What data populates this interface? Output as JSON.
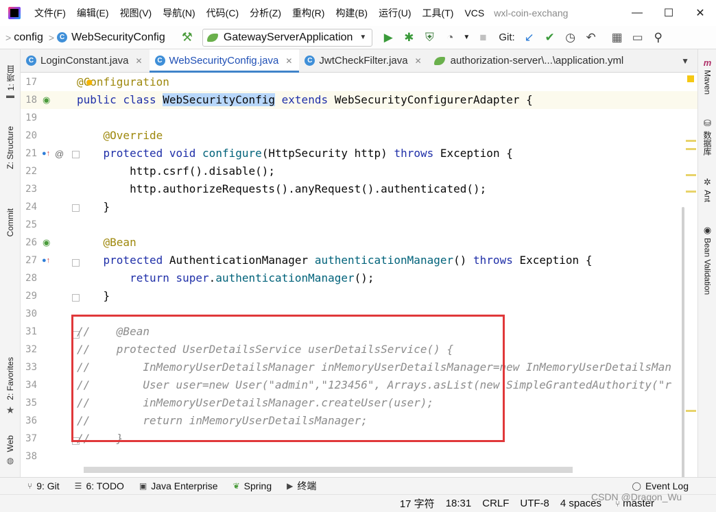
{
  "window": {
    "title": "wxl-coin-exchang",
    "menu": [
      "文件(F)",
      "编辑(E)",
      "视图(V)",
      "导航(N)",
      "代码(C)",
      "分析(Z)",
      "重构(R)",
      "构建(B)",
      "运行(U)",
      "工具(T)",
      "VCS"
    ],
    "controls": {
      "minimize": "—",
      "maximize": "☐",
      "close": "✕"
    }
  },
  "toolbar": {
    "breadcrumb_root": "config",
    "breadcrumb_file": "WebSecurityConfig",
    "run_config": "GatewayServerApplication",
    "git_label": "Git:"
  },
  "tabs": [
    {
      "label": "LoginConstant.java",
      "active": false
    },
    {
      "label": "WebSecurityConfig.java",
      "active": true
    },
    {
      "label": "JwtCheckFilter.java",
      "active": false
    },
    {
      "label": "authorization-server\\...\\application.yml",
      "active": false
    }
  ],
  "left_stripe": {
    "project": "1: 项目",
    "structure": "Z: Structure",
    "commit": "Commit",
    "favorites": "2: Favorites",
    "web": "Web"
  },
  "right_stripe": {
    "maven": "Maven",
    "database": "数据库",
    "ant": "Ant",
    "bean_validation": "Bean Validation",
    "maven_icon": "m"
  },
  "lines": [
    {
      "no": "17",
      "text": "@Configuration"
    },
    {
      "no": "18",
      "text": "public class WebSecurityConfig extends WebSecurityConfigurerAdapter {"
    },
    {
      "no": "19",
      "text": ""
    },
    {
      "no": "20",
      "text": "    @Override"
    },
    {
      "no": "21",
      "text": "    protected void configure(HttpSecurity http) throws Exception {"
    },
    {
      "no": "22",
      "text": "        http.csrf().disable();"
    },
    {
      "no": "23",
      "text": "        http.authorizeRequests().anyRequest().authenticated();"
    },
    {
      "no": "24",
      "text": "    }"
    },
    {
      "no": "25",
      "text": ""
    },
    {
      "no": "26",
      "text": "    @Bean"
    },
    {
      "no": "27",
      "text": "    protected AuthenticationManager authenticationManager() throws Exception {"
    },
    {
      "no": "28",
      "text": "        return super.authenticationManager();"
    },
    {
      "no": "29",
      "text": "    }"
    },
    {
      "no": "30",
      "text": ""
    },
    {
      "no": "31",
      "text": "//    @Bean"
    },
    {
      "no": "32",
      "text": "//    protected UserDetailsService userDetailsService() {"
    },
    {
      "no": "33",
      "text": "//        InMemoryUserDetailsManager inMemoryUserDetailsManager=new InMemoryUserDetailsMan"
    },
    {
      "no": "34",
      "text": "//        User user=new User(\"admin\",\"123456\", Arrays.asList(new SimpleGrantedAuthority(\"r"
    },
    {
      "no": "35",
      "text": "//        inMemoryUserDetailsManager.createUser(user);"
    },
    {
      "no": "36",
      "text": "//        return inMemoryUserDetailsManager;"
    },
    {
      "no": "37",
      "text": "//    }"
    },
    {
      "no": "38",
      "text": ""
    }
  ],
  "tool_windows": {
    "git": "9: Git",
    "todo": "6: TODO",
    "java_enterprise": "Java Enterprise",
    "spring": "Spring",
    "terminal": "终端",
    "event_log": "Event Log"
  },
  "status": {
    "chars": "17 字符",
    "position": "18:31",
    "line_sep": "CRLF",
    "encoding": "UTF-8",
    "indent": "4 spaces",
    "branch": "master",
    "watermark": "CSDN @Dragon_Wu"
  },
  "colors": {
    "accent": "#4083c9",
    "highlight_box": "#e0383a",
    "keyword": "#1f2fa8",
    "annotation": "#9e880d"
  }
}
